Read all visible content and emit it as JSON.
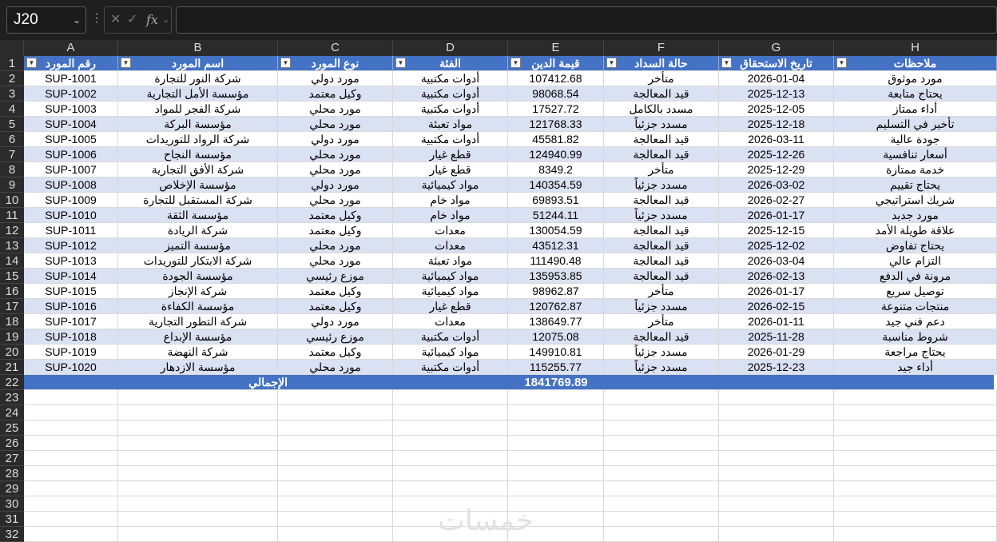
{
  "name_box": "J20",
  "columns": [
    "A",
    "B",
    "C",
    "D",
    "E",
    "F",
    "G",
    "H"
  ],
  "table": {
    "headers": [
      "رقم المورد",
      "اسم المورد",
      "نوع المورد",
      "الفئة",
      "قيمة الدين",
      "حالة السداد",
      "تاريخ الاستحقاق",
      "ملاحظات"
    ],
    "rows": [
      [
        "SUP-1001",
        "شركة النور للتجارة",
        "مورد دولي",
        "أدوات مكتبية",
        "107412.68",
        "متأخر",
        "2026-01-04",
        "مورد موثوق"
      ],
      [
        "SUP-1002",
        "مؤسسة الأمل التجارية",
        "وكيل معتمد",
        "أدوات مكتبية",
        "98068.54",
        "قيد المعالجة",
        "2025-12-13",
        "يحتاج متابعة"
      ],
      [
        "SUP-1003",
        "شركة الفجر للمواد",
        "مورد محلي",
        "أدوات مكتبية",
        "17527.72",
        "مسدد بالكامل",
        "2025-12-05",
        "أداء ممتاز"
      ],
      [
        "SUP-1004",
        "مؤسسة البركة",
        "مورد محلي",
        "مواد تعبئة",
        "121768.33",
        "مسدد جزئياً",
        "2025-12-18",
        "تأخير في التسليم"
      ],
      [
        "SUP-1005",
        "شركة الرواد للتوريدات",
        "مورد دولي",
        "أدوات مكتبية",
        "45581.82",
        "قيد المعالجة",
        "2026-03-11",
        "جودة عالية"
      ],
      [
        "SUP-1006",
        "مؤسسة النجاح",
        "مورد محلي",
        "قطع غيار",
        "124940.99",
        "قيد المعالجة",
        "2025-12-26",
        "أسعار تنافسية"
      ],
      [
        "SUP-1007",
        "شركة الأفق التجارية",
        "مورد محلي",
        "قطع غيار",
        "8349.2",
        "متأخر",
        "2025-12-29",
        "خدمة ممتازة"
      ],
      [
        "SUP-1008",
        "مؤسسة الإخلاص",
        "مورد دولي",
        "مواد كيميائية",
        "140354.59",
        "مسدد جزئياً",
        "2026-03-02",
        "يحتاج تقييم"
      ],
      [
        "SUP-1009",
        "شركة المستقبل للتجارة",
        "مورد محلي",
        "مواد خام",
        "69893.51",
        "قيد المعالجة",
        "2026-02-27",
        "شريك استراتيجي"
      ],
      [
        "SUP-1010",
        "مؤسسة الثقة",
        "وكيل معتمد",
        "مواد خام",
        "51244.11",
        "مسدد جزئياً",
        "2026-01-17",
        "مورد جديد"
      ],
      [
        "SUP-1011",
        "شركة الريادة",
        "وكيل معتمد",
        "معدات",
        "130054.59",
        "قيد المعالجة",
        "2025-12-15",
        "علاقة طويلة الأمد"
      ],
      [
        "SUP-1012",
        "مؤسسة التميز",
        "مورد محلي",
        "معدات",
        "43512.31",
        "قيد المعالجة",
        "2025-12-02",
        "يحتاج تفاوض"
      ],
      [
        "SUP-1013",
        "شركة الابتكار للتوريدات",
        "مورد محلي",
        "مواد تعبئة",
        "111490.48",
        "قيد المعالجة",
        "2026-03-04",
        "التزام عالي"
      ],
      [
        "SUP-1014",
        "مؤسسة الجودة",
        "موزع رئيسي",
        "مواد كيميائية",
        "135953.85",
        "قيد المعالجة",
        "2026-02-13",
        "مرونة في الدفع"
      ],
      [
        "SUP-1015",
        "شركة الإنجاز",
        "وكيل معتمد",
        "مواد كيميائية",
        "98962.87",
        "متأخر",
        "2026-01-17",
        "توصيل سريع"
      ],
      [
        "SUP-1016",
        "مؤسسة الكفاءة",
        "وكيل معتمد",
        "قطع غيار",
        "120762.87",
        "مسدد جزئياً",
        "2026-02-15",
        "منتجات متنوعة"
      ],
      [
        "SUP-1017",
        "شركة التطور التجارية",
        "مورد دولي",
        "معدات",
        "138649.77",
        "متأخر",
        "2026-01-11",
        "دعم فني جيد"
      ],
      [
        "SUP-1018",
        "مؤسسة الإبداع",
        "موزع رئيسي",
        "أدوات مكتبية",
        "12075.08",
        "قيد المعالجة",
        "2025-11-28",
        "شروط مناسبة"
      ],
      [
        "SUP-1019",
        "شركة النهضة",
        "وكيل معتمد",
        "مواد كيميائية",
        "149910.81",
        "مسدد جزئياً",
        "2026-01-29",
        "يحتاج مراجعة"
      ],
      [
        "SUP-1020",
        "مؤسسة الازدهار",
        "مورد محلي",
        "أدوات مكتبية",
        "115255.77",
        "مسدد جزئياً",
        "2025-12-23",
        "أداء جيد"
      ]
    ],
    "total_label": "الإجمالي",
    "total_value": "1841769.89"
  },
  "watermark": "خمسات",
  "colors": {
    "header_blue": "#4472c4",
    "band_blue": "#d9e1f2",
    "chrome_dark": "#1f1f1f"
  },
  "icons": [
    "chevron-down-icon",
    "more-options-icon",
    "cancel-icon",
    "enter-check-icon",
    "insert-function-icon",
    "filter-dropdown-icon"
  ]
}
